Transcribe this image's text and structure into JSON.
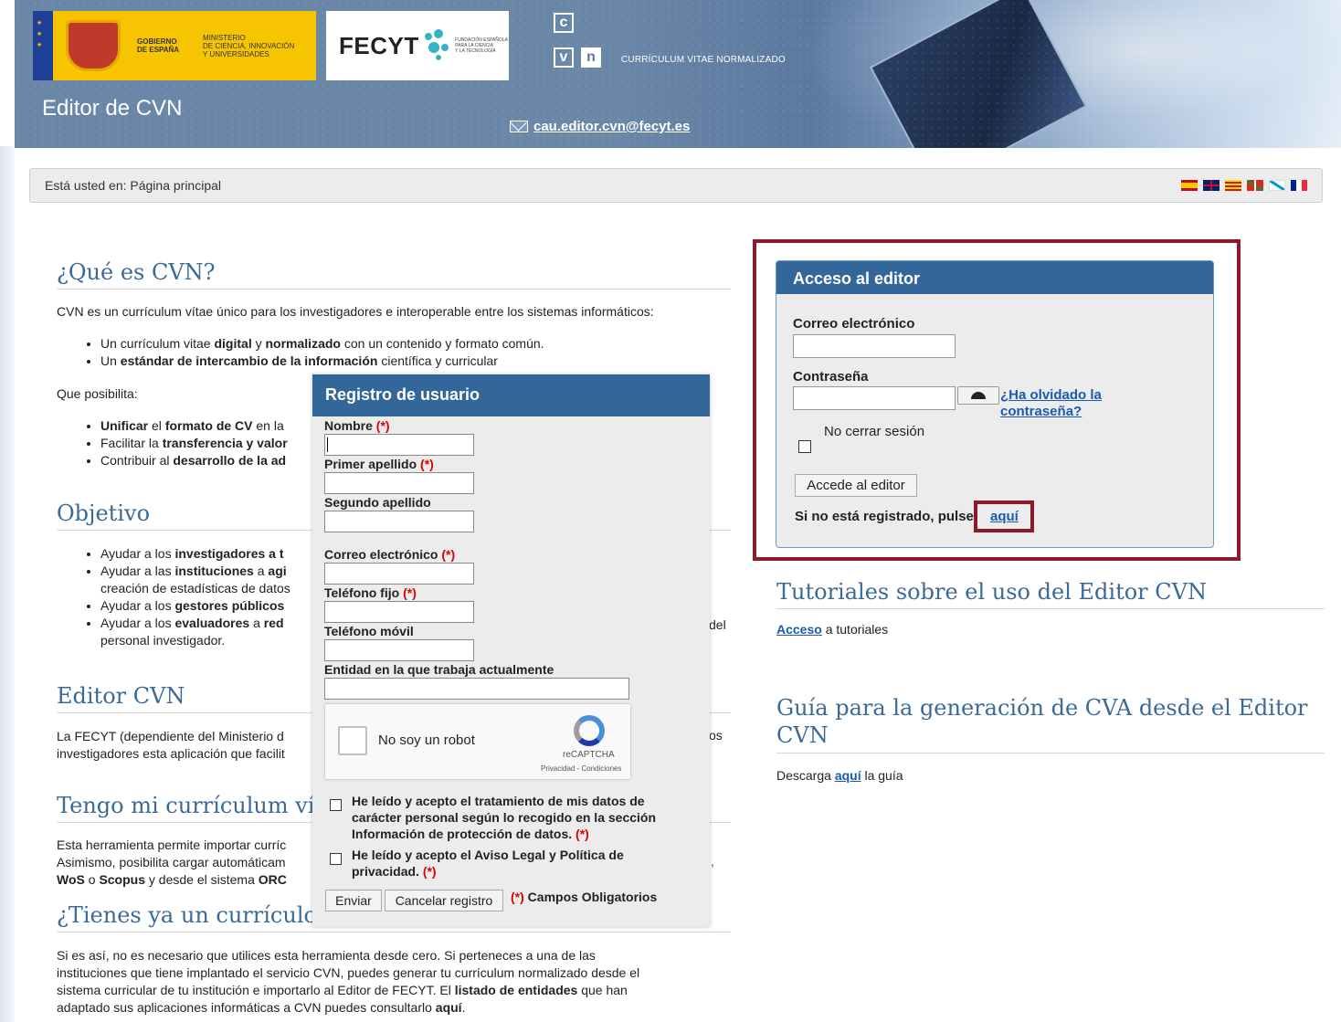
{
  "header": {
    "gov_line1": "GOBIERNO\nDE ESPAÑA",
    "gov_line2": "MINISTERIO\nDE CIENCIA, INNOVACIÓN\nY UNIVERSIDADES",
    "fecyt_name": "FECYT",
    "fecyt_sub": "FUNDACIÓN ESPAÑOLA\nPARA LA CIENCIA\nY LA TECNOLOGÍA",
    "cvn_letters": [
      "c",
      "v",
      "n"
    ],
    "cvn_tagline": "CURRÍCULUM VITAE NORMALIZADO",
    "editor_title": "Editor de CVN",
    "email": "cau.editor.cvn@fecyt.es"
  },
  "breadcrumb": {
    "text": "Está usted en: Página principal",
    "flags": [
      "es",
      "en",
      "ca",
      "eu",
      "gl",
      "fr"
    ]
  },
  "main": {
    "s1_title": "¿Qué es CVN?",
    "s1_intro": "CVN es un currículum vítae único para los investigadores e interoperable entre los sistemas informáticos:",
    "s1_b1_a": "Un currículum vitae ",
    "s1_b1_b": "digital",
    "s1_b1_c": " y ",
    "s1_b1_d": "normalizado",
    "s1_b1_e": " con un contenido y formato común.",
    "s1_b2_a": "Un ",
    "s1_b2_b": "estándar de intercambio de la información",
    "s1_b2_c": " científica y curricular",
    "s1_posibilita": "Que posibilita:",
    "s1_c1_a": "Unificar",
    "s1_c1_b": " el ",
    "s1_c1_c": "formato de CV",
    "s1_c1_d": " en la",
    "s1_c2_a": "Facilitar la ",
    "s1_c2_b": "transferencia y valor",
    "s1_c3_a": "Contribuir al ",
    "s1_c3_b": "desarrollo de la ad",
    "s2_title": "Objetivo",
    "s2_b1_a": "Ayudar a los ",
    "s2_b1_b": "investigadores a t",
    "s2_b2_a": "Ayudar a las ",
    "s2_b2_b": "instituciones",
    "s2_b2_c": " a ",
    "s2_b2_d": "agi",
    "s2_b2_e": "creación de estadísticas de datos",
    "s2_b3_a": "Ayudar a los ",
    "s2_b3_b": "gestores públicos",
    "s2_b4_a": "Ayudar a los ",
    "s2_b4_b": "evaluadores",
    "s2_b4_c": " a ",
    "s2_b4_d": "red",
    "s2_b4_tail": "del",
    "s2_b4_e": "personal investigador.",
    "s3_title": "Editor CVN",
    "s3_p1": "La FECYT (dependiente del Ministerio d",
    "s3_p1_tail": "os",
    "s3_p2": "investigadores esta aplicación que facilit",
    "s4_title": "Tengo mi currículum vít",
    "s4_p1": "Esta herramienta permite importar curríc",
    "s4_p2": "Asimismo, posibilita cargar automáticam",
    "s4_p2_tail": ",",
    "s4_p3_a": "WoS",
    "s4_p3_b": " o ",
    "s4_p3_c": "Scopus",
    "s4_p3_d": " y desde el sistema ",
    "s4_p3_e": "ORC",
    "s5_title": "¿Tienes ya un currículo",
    "s5_p1": "Si es así, no es necesario que utilices esta herramienta desde cero. Si perteneces a una de las",
    "s5_p2": "instituciones que tiene implantado el servicio CVN, puedes generar tu currículum normalizado desde el",
    "s5_p3_a": "sistema curricular de tu institución e importarlo al Editor de FECYT. El ",
    "s5_p3_b": "listado de entidades",
    "s5_p3_c": " que han",
    "s5_p4_a": "adaptado sus aplicaciones informáticas a CVN puedes consultarlo ",
    "s5_p4_b": "aquí",
    "s5_p4_c": "."
  },
  "access": {
    "title": "Acceso al editor",
    "email_label": "Correo electrónico",
    "email_value": "",
    "password_label": "Contraseña",
    "password_value": "",
    "forgot": "¿Ha olvidado la contraseña?",
    "keep_session": "No cerrar sesión",
    "submit": "Accede al editor",
    "register_text": "Si no está registrado, pulse",
    "register_link": "aquí"
  },
  "right": {
    "tut_title": "Tutoriales sobre el uso del Editor CVN",
    "tut_link": "Acceso",
    "tut_text": " a tutoriales",
    "guide_title": "Guía para la generación de CVA desde el Editor CVN",
    "guide_prefix": "Descarga ",
    "guide_link": "aquí",
    "guide_suffix": " la guía"
  },
  "modal": {
    "title": "Registro de usuario",
    "required_mark": "(*)",
    "nombre_label": "Nombre",
    "apellido1_label": "Primer apellido",
    "apellido2_label": "Segundo apellido",
    "correo_label": "Correo electrónico",
    "tel_fijo_label": "Teléfono fijo",
    "tel_movil_label": "Teléfono móvil",
    "entidad_label": "Entidad en la que trabaja actualmente",
    "captcha_label": "No soy un robot",
    "captcha_brand": "reCAPTCHA",
    "captcha_links": "Privacidad - Condiciones",
    "chk1_line1": "He leído y acepto el tratamiento de mis datos de",
    "chk1_line2": "carácter personal según lo recogido en la sección",
    "chk1_line3": "Información de protección de datos.",
    "chk2_line1": "He leído y acepto el Aviso Legal y Política de",
    "chk2_line2": "privacidad.",
    "send": "Enviar",
    "cancel": "Cancelar registro",
    "required_note": "Campos Obligatorios"
  },
  "colors": {
    "accent_blue": "#336699",
    "title_blue": "#3a6a98",
    "link_blue": "#1a5ab0",
    "highlight": "#8b1a2b",
    "required_red": "#dd0000"
  }
}
